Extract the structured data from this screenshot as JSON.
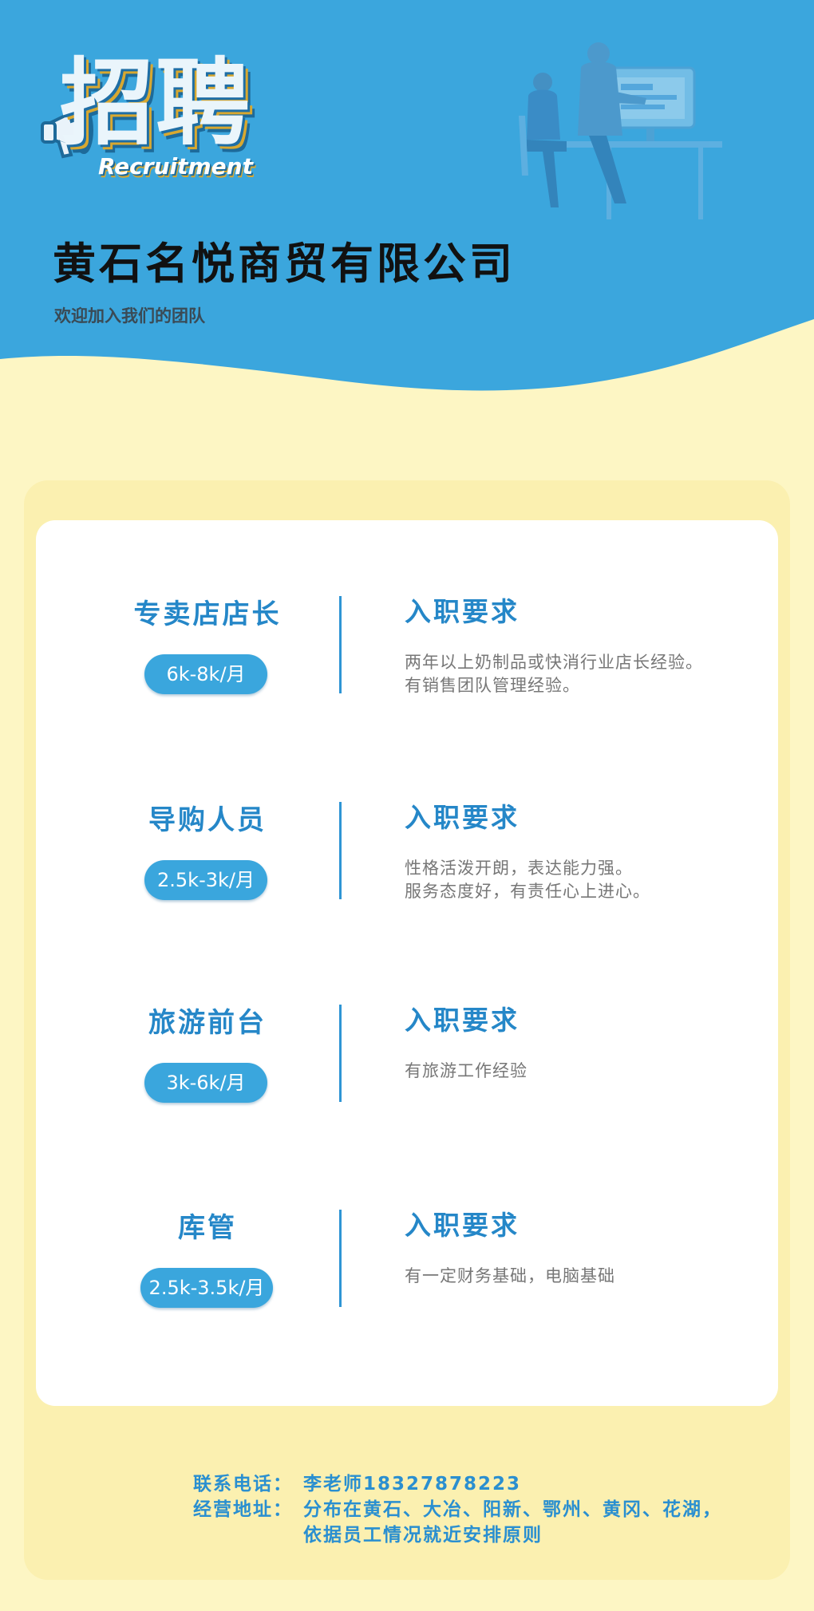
{
  "header": {
    "logo_text": "招聘",
    "logo_sub": "Recruitment",
    "company": "黄石名悦商贸有限公司",
    "tagline": "欢迎加入我们的团队"
  },
  "jobs": [
    {
      "title": "专卖店店长",
      "salary": "6k-8k/月",
      "req_title": "入职要求",
      "requirements": [
        "两年以上奶制品或快消行业店长经验。",
        "有销售团队管理经验。"
      ]
    },
    {
      "title": "导购人员",
      "salary": "2.5k-3k/月",
      "req_title": "入职要求",
      "requirements": [
        "性格活泼开朗，表达能力强。",
        "服务态度好，有责任心上进心。"
      ]
    },
    {
      "title": "旅游前台",
      "salary": "3k-6k/月",
      "req_title": "入职要求",
      "requirements": [
        "有旅游工作经验"
      ]
    },
    {
      "title": "库管",
      "salary": "2.5k-3.5k/月",
      "req_title": "入职要求",
      "requirements": [
        "有一定财务基础，电脑基础"
      ]
    }
  ],
  "contact": {
    "phone_label": "联系电话：",
    "phone_value": "李老师18327878223",
    "address_label": "经营地址：",
    "address_line1": "分布在黄石、大冶、阳新、鄂州、黄冈、花湖，",
    "address_line2": "依据员工情况就近安排原则"
  },
  "colors": {
    "header_blue": "#3ba6dd",
    "page_yellow": "#fdf6c4",
    "accent_blue": "#2587c8",
    "salary_pill": "#3aa6dd"
  },
  "icons": [
    "megaphone-icon",
    "office-worker-illustration"
  ]
}
